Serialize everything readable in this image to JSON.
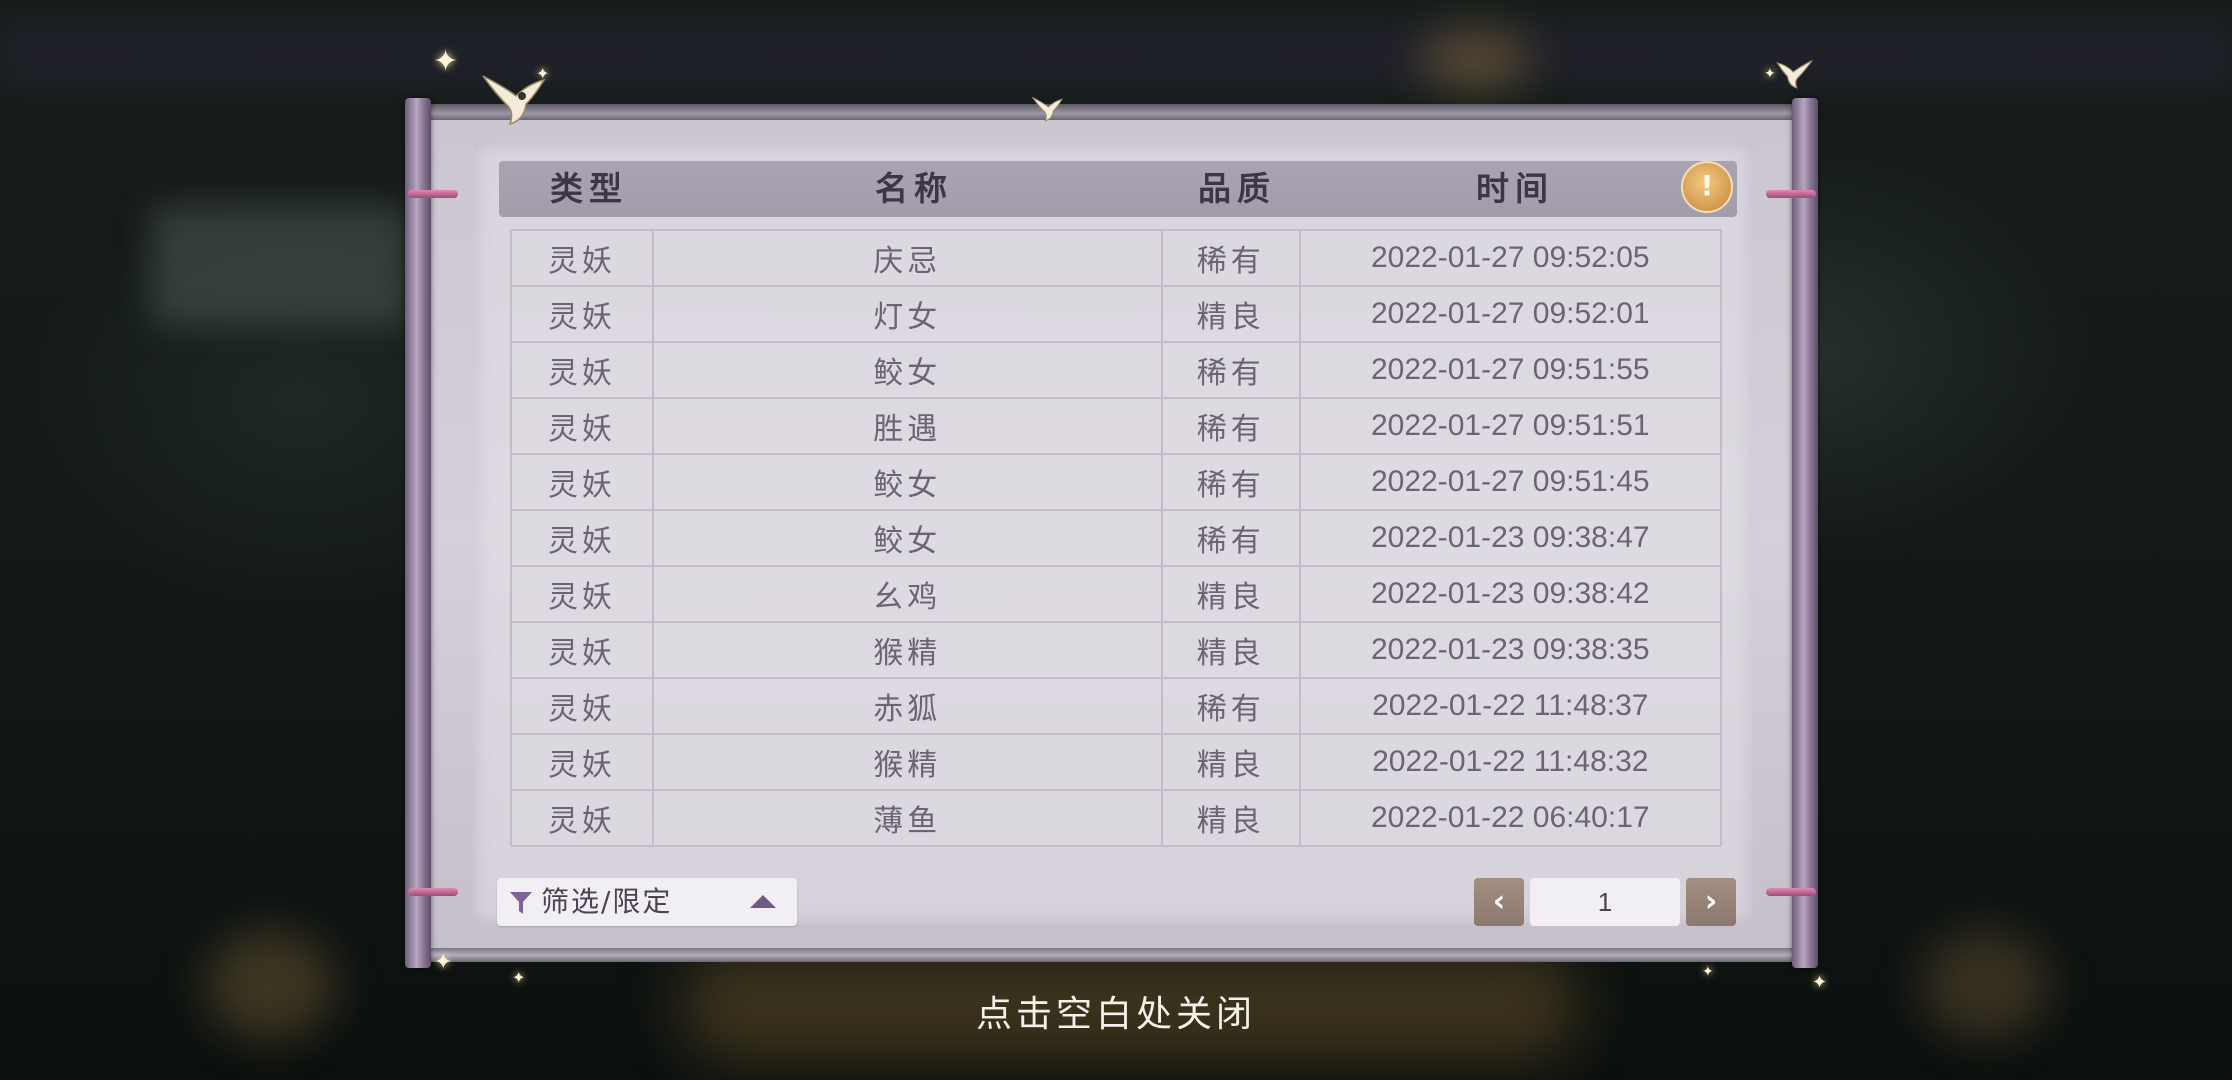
{
  "table": {
    "headers": [
      "类型",
      "名称",
      "品质",
      "时间"
    ],
    "rows": [
      [
        "灵妖",
        "庆忌",
        "稀有",
        "2022-01-27  09:52:05"
      ],
      [
        "灵妖",
        "灯女",
        "精良",
        "2022-01-27  09:52:01"
      ],
      [
        "灵妖",
        "鲛女",
        "稀有",
        "2022-01-27  09:51:55"
      ],
      [
        "灵妖",
        "胜遇",
        "稀有",
        "2022-01-27  09:51:51"
      ],
      [
        "灵妖",
        "鲛女",
        "稀有",
        "2022-01-27  09:51:45"
      ],
      [
        "灵妖",
        "鲛女",
        "稀有",
        "2022-01-23  09:38:47"
      ],
      [
        "灵妖",
        "幺鸡",
        "精良",
        "2022-01-23  09:38:42"
      ],
      [
        "灵妖",
        "猴精",
        "精良",
        "2022-01-23  09:38:35"
      ],
      [
        "灵妖",
        "赤狐",
        "稀有",
        "2022-01-22  11:48:37"
      ],
      [
        "灵妖",
        "猴精",
        "精良",
        "2022-01-22  11:48:32"
      ],
      [
        "灵妖",
        "薄鱼",
        "精良",
        "2022-01-22  06:40:17"
      ]
    ]
  },
  "tip_icon": "!",
  "filter": {
    "label": "筛选/限定",
    "icon": "funnel-icon",
    "expand_icon": "triangle-up-icon"
  },
  "pagination": {
    "page": "1",
    "prev_icon": "‹",
    "next_icon": "›"
  },
  "close_hint": "点击空白处关闭",
  "colors": {
    "header_bg": "#a39dab",
    "text": "#6a6474",
    "nav_btn": "#957f72"
  }
}
